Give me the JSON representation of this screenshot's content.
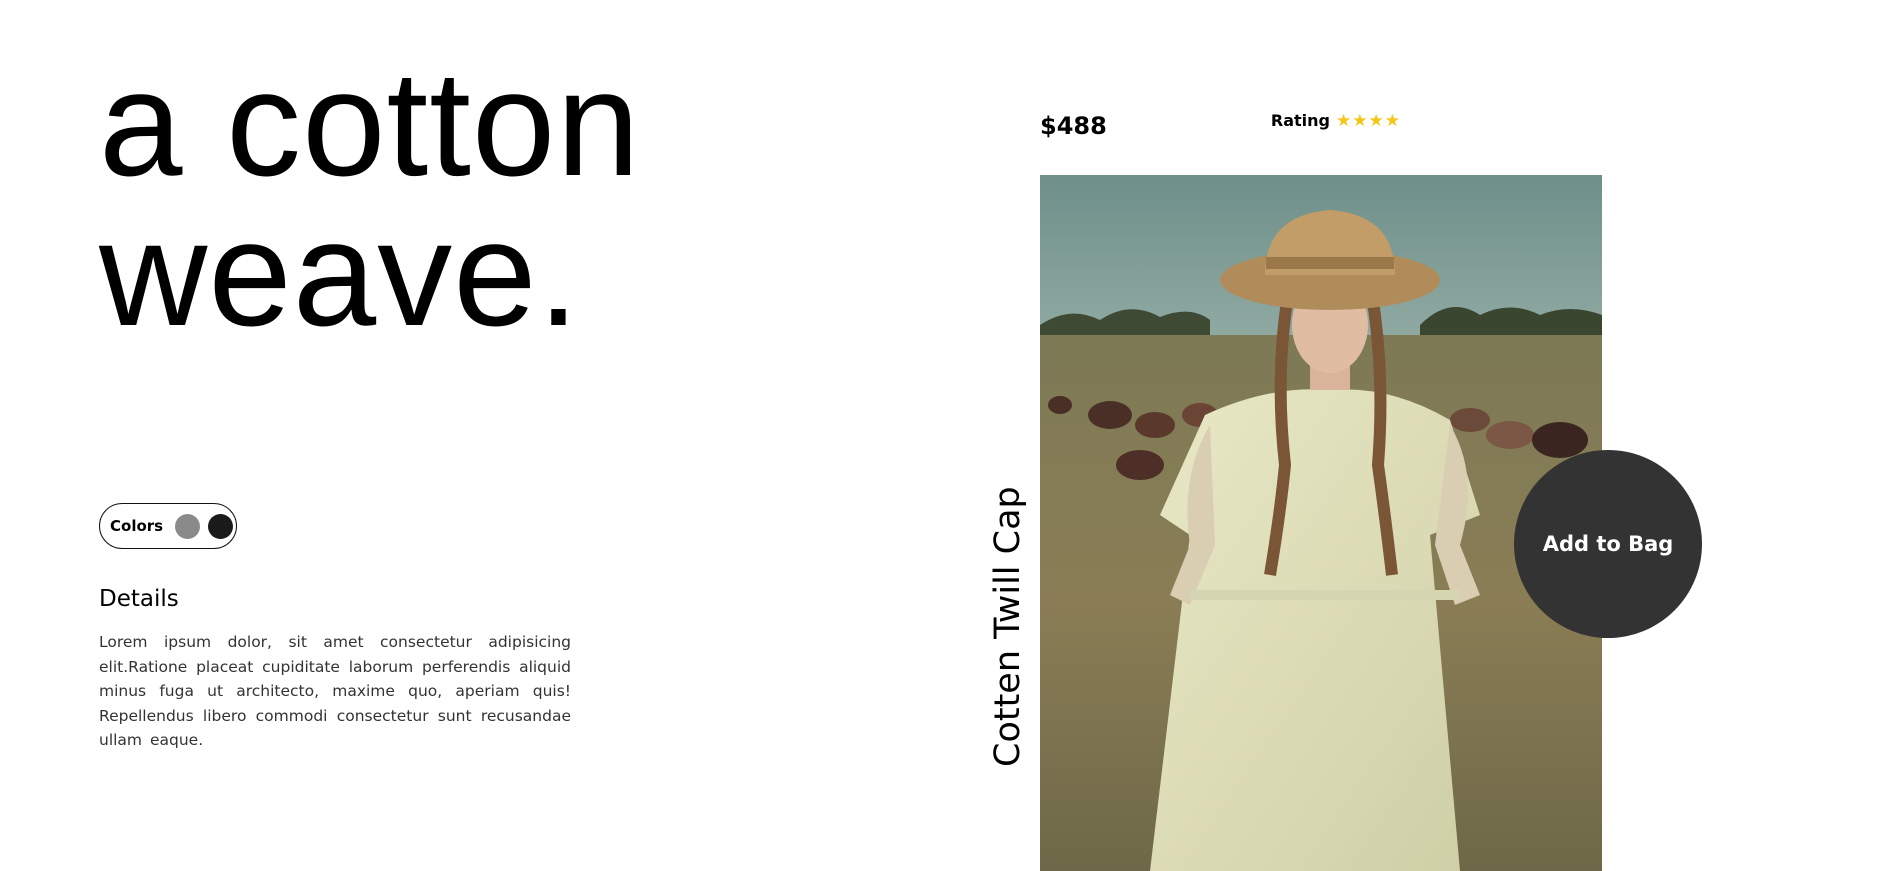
{
  "hero": {
    "line1": "a cotton",
    "line2": "weave."
  },
  "colors": {
    "label": "Colors",
    "swatches": [
      {
        "name": "gray",
        "color": "#8a8a8a"
      },
      {
        "name": "black",
        "color": "#1a1a1a"
      }
    ]
  },
  "details": {
    "title": "Details",
    "body": "Lorem ipsum dolor, sit amet consectetur adipisicing elit.Ratione placeat cupiditate laborum perferendis aliquid minus fuga ut architecto, maxime quo, aperiam quis! Repellendus libero commodi consectetur sunt recusandae ullam eaque."
  },
  "product": {
    "price": "$488",
    "rating_label": "Rating",
    "rating_stars": 4,
    "star_color": "#f5c518",
    "name": "Cotten Twill Cap",
    "image_icon": "model-photo"
  },
  "actions": {
    "add_to_bag": "Add to Bag",
    "button_color": "#333333"
  }
}
